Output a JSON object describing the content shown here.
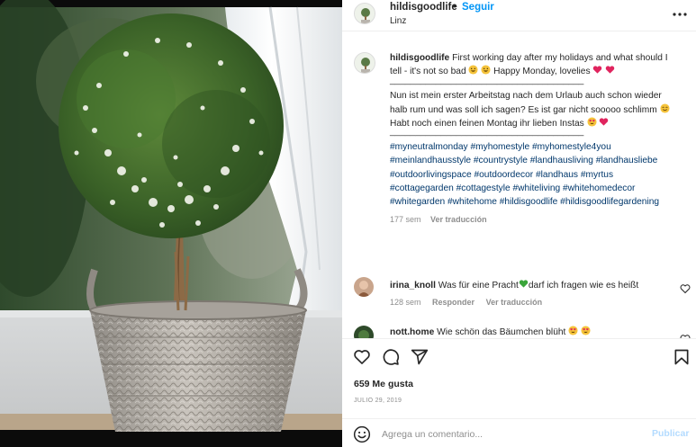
{
  "post": {
    "username": "hildisgoodlife",
    "dot": "•",
    "follow_label": "Seguir",
    "location": "Linz",
    "more_icon": "more-horizontal-icon"
  },
  "caption": {
    "username": "hildisgoodlife",
    "line1": "First working day after my holidays and what should I tell - it's not so bad",
    "line1_end": "Happy Monday, lovelies",
    "divider1": "______________________________________",
    "line2": "Nun ist mein erster Arbeitstag nach dem Urlaub auch schon wieder halb rum und was soll ich sagen? Es ist gar nicht sooooo schlimm",
    "line2_mid": "Habt noch einen feinen Montag ihr lieben Instas",
    "divider2": "______________________________________",
    "hashtags": "#myneutralmonday #myhomestyle #myhomestyle4you #meinlandhausstyle #countrystyle #landhausliving #landhausliebe #outdoorlivingspace #outdoordecor #landhaus #myrtus #cottagegarden #cottagestyle #whiteliving #whitehomedecor #whitegarden #whitehome #hildisgoodlife #hildisgoodlifegardening",
    "time": "177 sem",
    "translate": "Ver traducción"
  },
  "comments": [
    {
      "username": "irina_knoll",
      "text": "Was für eine Pracht",
      "text_end": "darf ich fragen wie es heißt",
      "time": "128 sem",
      "reply": "Responder",
      "translate": "Ver traducción"
    },
    {
      "username": "nott.home",
      "text": "Wie schön das Bäumchen blüht"
    }
  ],
  "actions": {
    "like_icon": "heart-icon",
    "comment_icon": "comment-icon",
    "share_icon": "share-icon",
    "save_icon": "bookmark-icon"
  },
  "likes": "659 Me gusta",
  "date": "JULIO 29, 2019",
  "add_comment": {
    "placeholder": "Agrega un comentario...",
    "publish_label": "Publicar"
  },
  "colors": {
    "link_blue": "#0095f6",
    "hashtag_blue": "#00376b",
    "muted": "#8e8e8e",
    "publish_disabled": "#b3dbff"
  }
}
